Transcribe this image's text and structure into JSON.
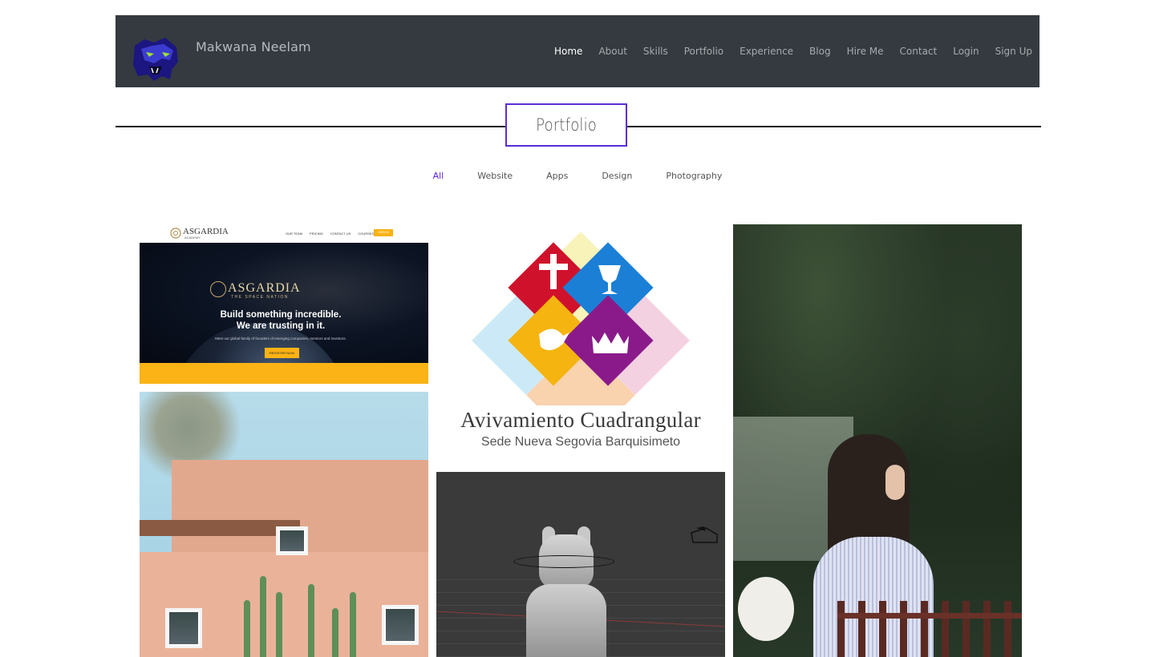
{
  "brand": {
    "name": "Makwana Neelam",
    "logo_icon": "panther-logo-icon"
  },
  "nav": {
    "items": [
      {
        "label": "Home",
        "active": true
      },
      {
        "label": "About"
      },
      {
        "label": "Skills"
      },
      {
        "label": "Portfolio"
      },
      {
        "label": "Experience"
      },
      {
        "label": "Blog"
      },
      {
        "label": "Hire Me"
      },
      {
        "label": "Contact"
      },
      {
        "label": "Login"
      },
      {
        "label": "Sign Up"
      }
    ]
  },
  "section": {
    "title": "Portfolio"
  },
  "filters": [
    {
      "label": "All",
      "active": true
    },
    {
      "label": "Website"
    },
    {
      "label": "Apps"
    },
    {
      "label": "Design"
    },
    {
      "label": "Photography"
    }
  ],
  "portfolio": {
    "asgardia": {
      "logo": "ASGARDIA",
      "logo_sub": "ACADEMY",
      "menu": [
        "OUR TEAM",
        "PRICING",
        "CONTACT US",
        "COURSES"
      ],
      "menu_button": "SIGN IN",
      "hero_brand": "ASGARDIA",
      "hero_sub": "THE SPACE NATION",
      "headline_1": "Build something incredible.",
      "headline_2": "We are trusting in it.",
      "body": "Meet our global family of founders of emerging companies, mentors and investors.",
      "cta": "REGISTER NOW"
    },
    "logo_design": {
      "title": "Avivamiento Cuadrangular",
      "subtitle": "Sede Nueva Segovia Barquisimeto"
    }
  },
  "colors": {
    "navbar_bg": "#343a40",
    "accent": "#5c20d3",
    "asgardia_yellow": "#fbb315"
  }
}
